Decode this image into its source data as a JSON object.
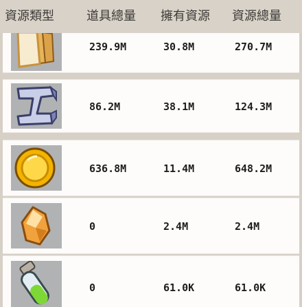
{
  "header": {
    "resource_type": "資源類型",
    "item_total": "道具總量",
    "owned_resource": "擁有資源",
    "resource_total": "資源總量"
  },
  "rows": [
    {
      "icon": "bread-icon",
      "item_total": "239.9M",
      "owned": "30.8M",
      "total": "270.7M"
    },
    {
      "icon": "iron-ingot-icon",
      "item_total": "86.2M",
      "owned": "38.1M",
      "total": "124.3M"
    },
    {
      "icon": "gold-coin-icon",
      "item_total": "636.8M",
      "owned": "11.4M",
      "total": "648.2M"
    },
    {
      "icon": "amber-crystal-icon",
      "item_total": "0",
      "owned": "2.4M",
      "total": "2.4M"
    },
    {
      "icon": "green-potion-vial-icon",
      "item_total": "0",
      "owned": "61.0K",
      "total": "61.0K"
    }
  ]
}
